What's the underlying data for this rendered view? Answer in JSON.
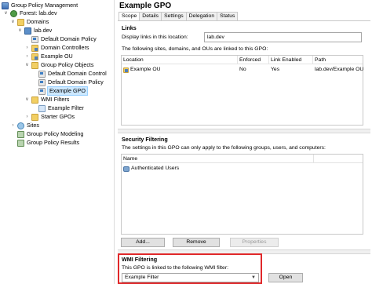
{
  "tree": {
    "root": "Group Policy Management",
    "forest": "Forest: lab.dev",
    "domains": "Domains",
    "domain": "lab.dev",
    "default_domain_policy": "Default Domain Policy",
    "domain_controllers": "Domain Controllers",
    "example_ou": "Example OU",
    "group_policy_objects": "Group Policy Objects",
    "gpo_default_dc": "Default Domain Control",
    "gpo_default_domain": "Default Domain Policy",
    "gpo_example": "Example GPO",
    "wmi_filters": "WMI Filters",
    "wmi_example_filter": "Example Filter",
    "starter_gpos": "Starter GPOs",
    "sites": "Sites",
    "modeling": "Group Policy Modeling",
    "results": "Group Policy Results"
  },
  "header": {
    "title": "Example GPO"
  },
  "tabs": [
    "Scope",
    "Details",
    "Settings",
    "Delegation",
    "Status"
  ],
  "links": {
    "title": "Links",
    "display_label": "Display links in this location:",
    "display_value": "lab.dev",
    "description": "The following sites, domains, and OUs are linked to this GPO:",
    "columns": [
      "Location",
      "Enforced",
      "Link Enabled",
      "Path"
    ],
    "rows": [
      {
        "location": "Example OU",
        "enforced": "No",
        "link_enabled": "Yes",
        "path": "lab.dev/Example OU"
      }
    ]
  },
  "security": {
    "title": "Security Filtering",
    "description": "The settings in this GPO can only apply to the following groups, users, and computers:",
    "column": "Name",
    "rows": [
      "Authenticated Users"
    ],
    "add": "Add...",
    "remove": "Remove",
    "properties": "Properties"
  },
  "wmi": {
    "title": "WMI Filtering",
    "description": "This GPO is linked to the following WMI filter:",
    "selected": "Example Filter",
    "open": "Open"
  },
  "colors": {
    "highlight": "#e0282a",
    "selection": "#cce8ff"
  }
}
